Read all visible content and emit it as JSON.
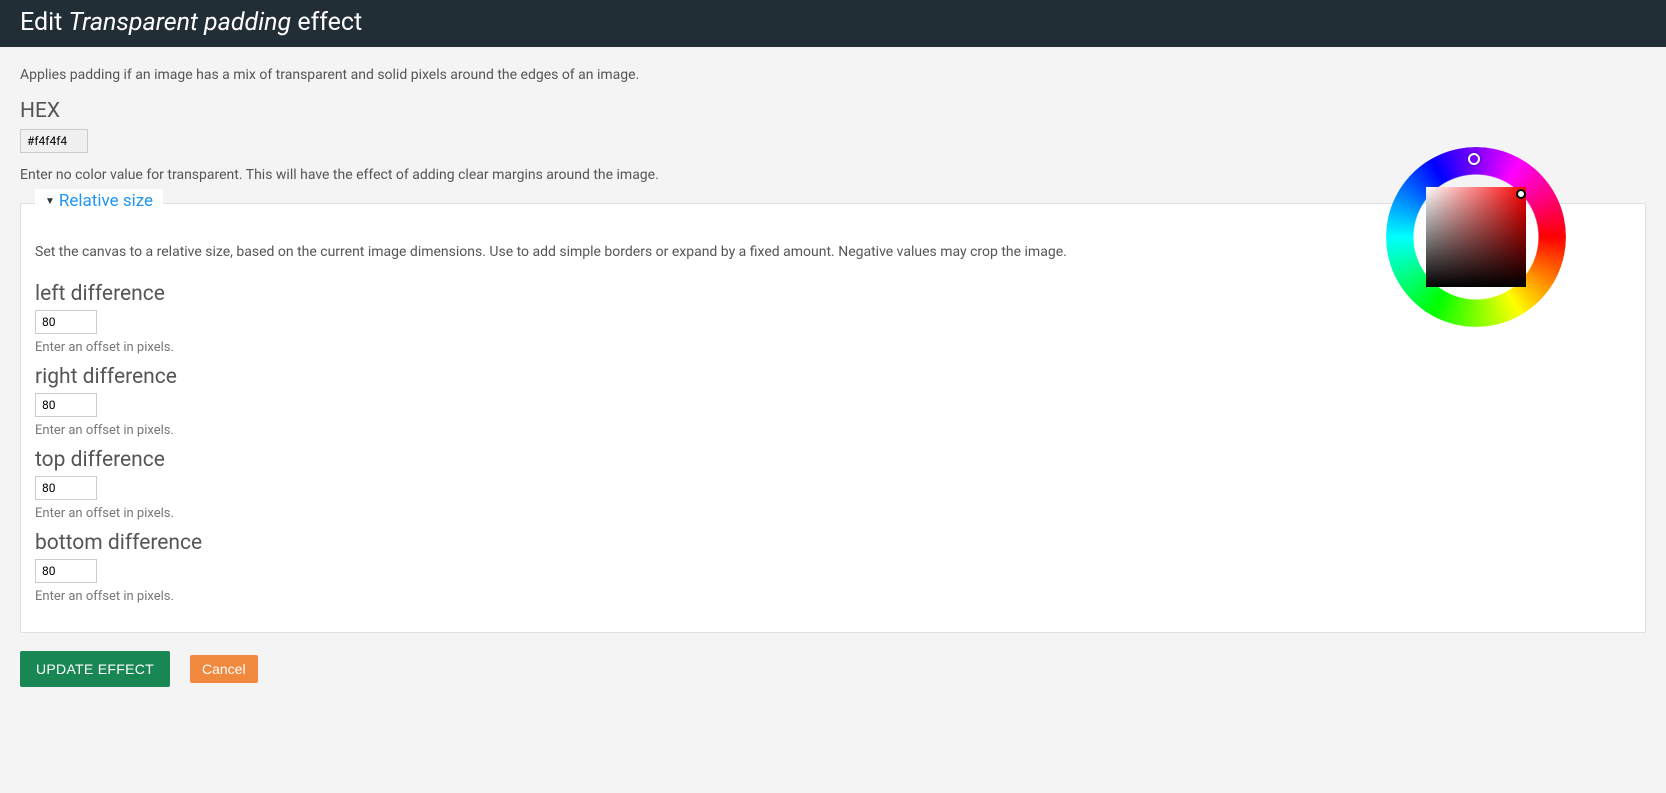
{
  "header": {
    "prefix": "Edit ",
    "effectName": "Transparent padding",
    "suffix": " effect"
  },
  "description": "Applies padding if an image has a mix of transparent and solid pixels around the edges of an image.",
  "hex": {
    "label": "HEX",
    "value": "#f4f4f4",
    "help": "Enter no color value for transparent. This will have the effect of adding clear margins around the image."
  },
  "panel": {
    "title": "Relative size",
    "description": "Set the canvas to a relative size, based on the current image dimensions. Use to add simple borders or expand by a fixed amount. Negative values may crop the image.",
    "fieldHelp": "Enter an offset in pixels.",
    "left": {
      "label": "left difference",
      "value": "80"
    },
    "right": {
      "label": "right difference",
      "value": "80"
    },
    "top": {
      "label": "top difference",
      "value": "80"
    },
    "bottom": {
      "label": "bottom difference",
      "value": "80"
    }
  },
  "actions": {
    "update": "UPDATE EFFECT",
    "cancel": "Cancel"
  }
}
